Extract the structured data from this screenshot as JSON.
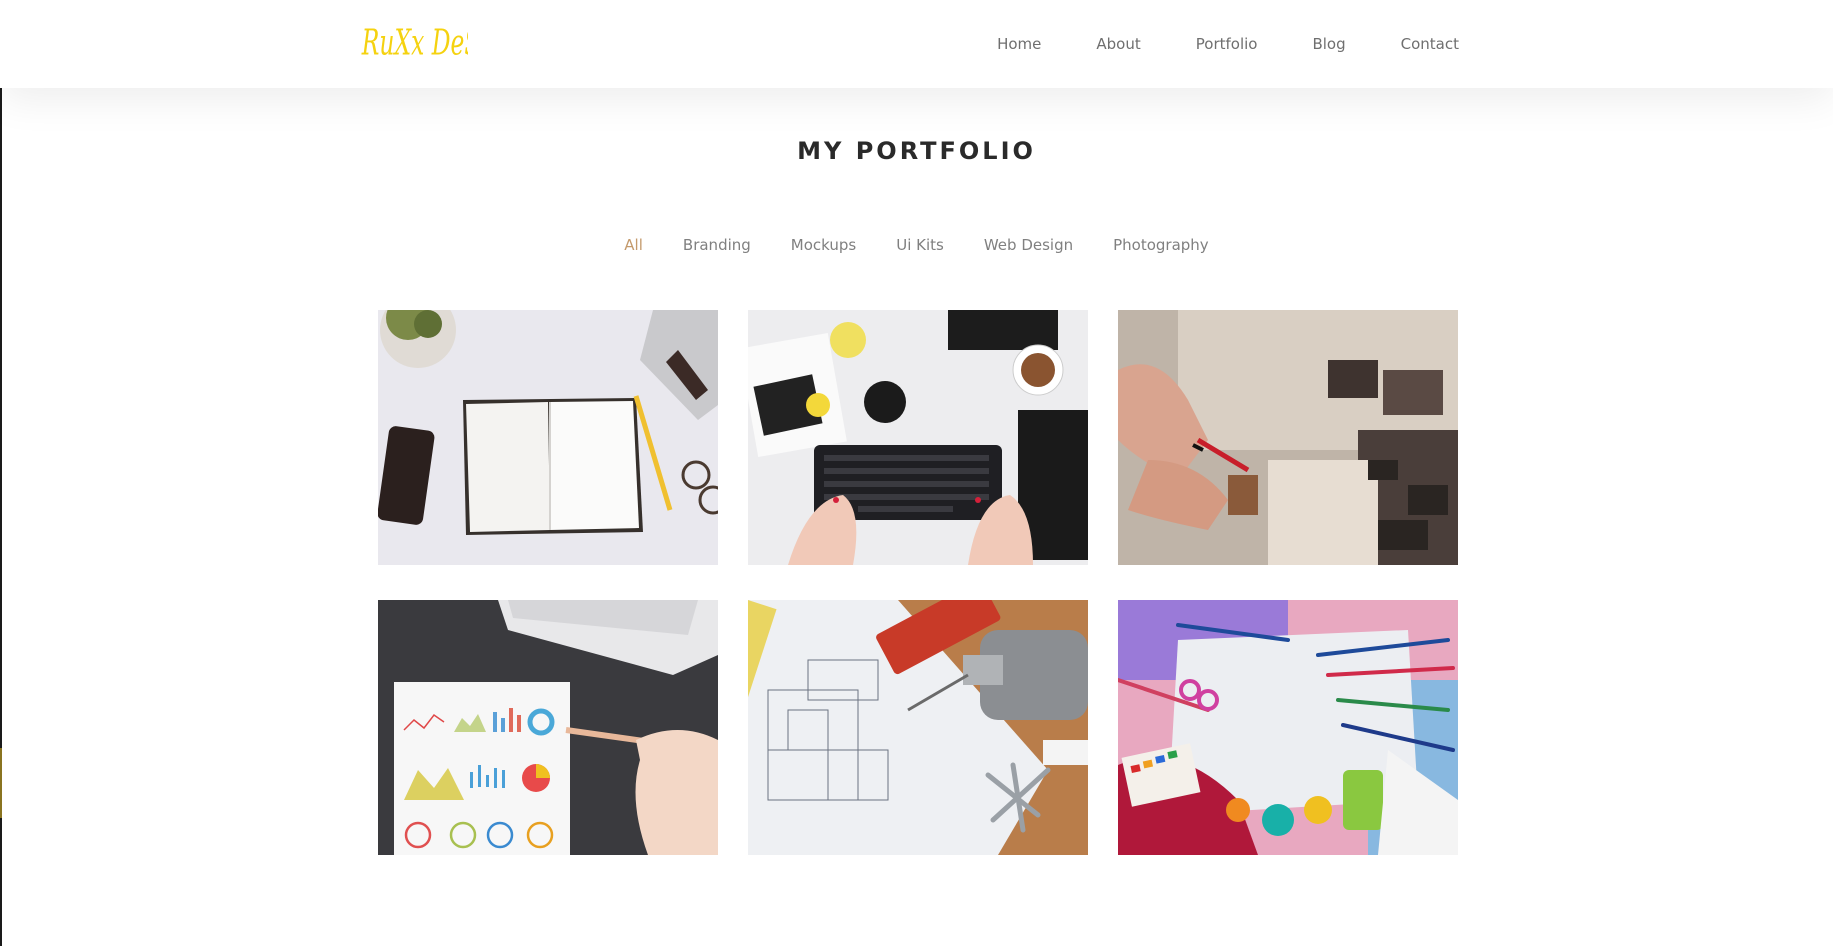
{
  "brand": {
    "logo_text": "RuXx DeSiGn",
    "logo_color": "#f5d20f"
  },
  "nav": {
    "items": [
      {
        "label": "Home"
      },
      {
        "label": "About"
      },
      {
        "label": "Portfolio"
      },
      {
        "label": "Blog"
      },
      {
        "label": "Contact"
      }
    ]
  },
  "section": {
    "title": "MY PORTFOLIO"
  },
  "filters": {
    "active_color": "#c49a6c",
    "items": [
      {
        "label": "All",
        "active": true
      },
      {
        "label": "Branding"
      },
      {
        "label": "Mockups"
      },
      {
        "label": "Ui Kits"
      },
      {
        "label": "Web Design"
      },
      {
        "label": "Photography"
      }
    ]
  },
  "portfolio": {
    "items": [
      {
        "subject": "notebook-desk-photo"
      },
      {
        "subject": "keyboard-creative-mess-photo"
      },
      {
        "subject": "hand-drawing-collage-photo"
      },
      {
        "subject": "charts-report-photo"
      },
      {
        "subject": "blueprint-drill-tools-photo"
      },
      {
        "subject": "art-supplies-photo"
      }
    ]
  }
}
